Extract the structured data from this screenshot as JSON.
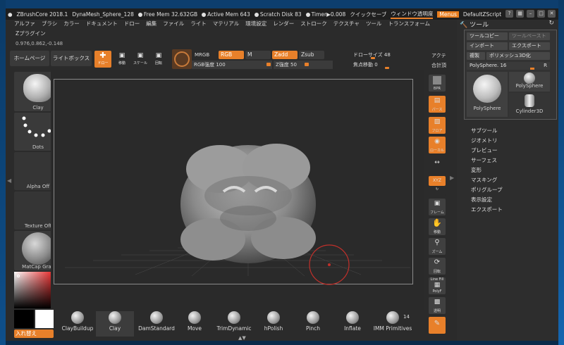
{
  "titlebar": {
    "app": "ZBrushCore 2018.1",
    "doc": "DynaMesh_Sphere_128",
    "free_mem": "Free Mem 32.632GB",
    "active_mem": "Active Mem 643",
    "scratch": "Scratch Disk 83",
    "timer": "Timer▶0.008",
    "quicksave": "クイックセーブ",
    "window_transparency": "ウィンドウ透明度",
    "menus": "Menus",
    "script": "DefaultZScript"
  },
  "menubar": [
    "アルファ",
    "ブラシ",
    "カラー",
    "ドキュメント",
    "ドロー",
    "編集",
    "ファイル",
    "ライト",
    "マテリアル",
    "環境設定",
    "レンダー",
    "ストローク",
    "テクスチャ",
    "ツール",
    "トランスフォーム"
  ],
  "zplugin": "Zプラグイン",
  "coords": "0.976,0.862,-0.148",
  "toolbar": {
    "home": "ホームページ",
    "lightbox": "ライトボックス",
    "draw": "ドロー",
    "move": "移動",
    "scale": "スケール",
    "rotate": "回転",
    "mrgb": "MRGB",
    "rgb": "RGB",
    "m": "M",
    "zadd": "Zadd",
    "zsub": "Zsub",
    "rgb_intensity": "RGB強度 100",
    "z_intensity": "Z強度 50",
    "draw_size": "ドローサイズ 48",
    "focal_shift": "焦点移動 0",
    "active": "アクテ",
    "total": "合計頂"
  },
  "left_panel": {
    "clay": "Clay",
    "dots": "Dots",
    "alpha": "Alpha Off",
    "texture": "Texture Off",
    "matcap": "MatCap Gray",
    "swap": "入れ替え"
  },
  "right_tools": {
    "bpr": "BPR",
    "perspective": "パース",
    "floor": "フロア",
    "local": "ローカル",
    "xyz": "XYZ",
    "frame": "フレーム",
    "move": "移動",
    "zoom": "ズーム",
    "rotate": "回転",
    "line_fill": "Line Fill",
    "polyf": "PolyF",
    "transparent": "透明"
  },
  "right_panel": {
    "title": "ツール",
    "copy_tool": "ツールコピー",
    "paste_tool": "ツールペースト",
    "import": "インポート",
    "export": "エクスポート",
    "clone": "複製",
    "polymesh3d": "ポリメッシュ3D化",
    "polysphere_slider": "PolySphere. 16",
    "r": "R",
    "polysphere_big": "PolySphere",
    "polysphere_small": "PolySphere",
    "cylinder": "Cylinder3D",
    "items": [
      "サブツール",
      "ジオメトリ",
      "プレビュー",
      "サーフェス",
      "変形",
      "マスキング",
      "ポリグループ",
      "表示設定",
      "エクスポート"
    ]
  },
  "brushes": [
    "ClayBuildup",
    "Clay",
    "DamStandard",
    "Move",
    "TrimDynamic",
    "hPolish",
    "Pinch",
    "Inflate",
    "IMM Primitives"
  ],
  "brush_count": "14",
  "colors": {
    "accent": "#e8802a",
    "bg": "#2b2b2b"
  }
}
